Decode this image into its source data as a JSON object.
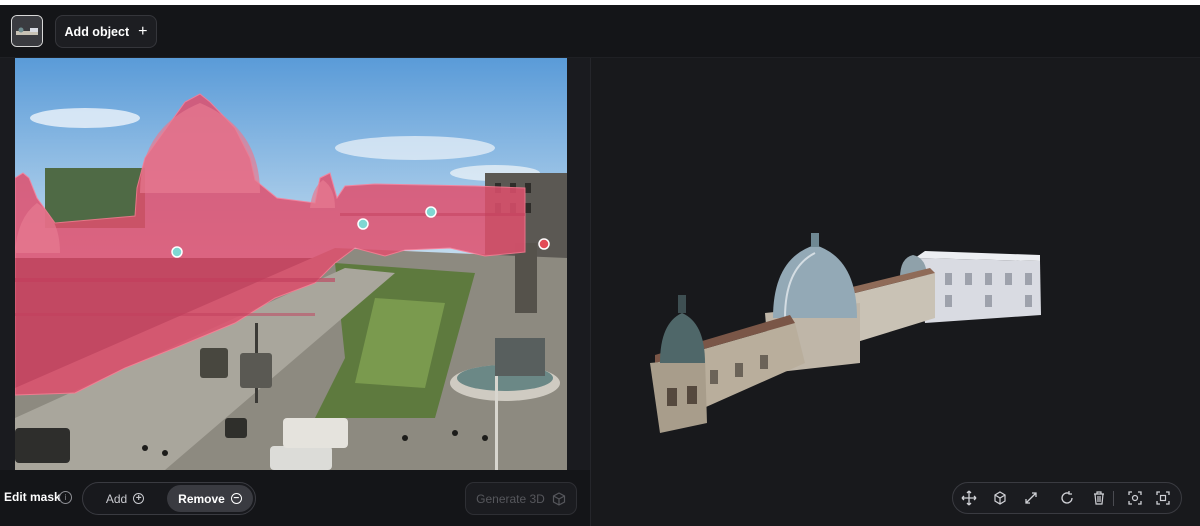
{
  "toolbar": {
    "thumbnail_icon": "object-thumbnail-icon",
    "add_object_label": "Add object",
    "add_object_icon": "+"
  },
  "mask_panel": {
    "edit_mask_label": "Edit mask",
    "info_icon": "i",
    "add_label": "Add",
    "add_icon": "+",
    "remove_label": "Remove",
    "remove_icon": "−",
    "selected_mode": "Remove",
    "generate_label": "Generate 3D",
    "generate_icon": "cube-icon"
  },
  "viewer_toolbar": {
    "tools": [
      "move-icon",
      "rotate-object-icon",
      "scale-icon",
      "reset-icon",
      "delete-icon",
      "focus-icon",
      "frame-icon"
    ]
  },
  "colors": {
    "mask": "#e0506e",
    "accent": "#ffffff",
    "background": "#141518"
  }
}
